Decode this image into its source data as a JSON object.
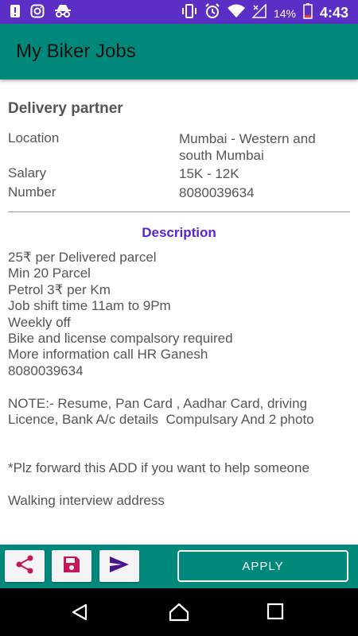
{
  "status_bar": {
    "battery_percent": "14%",
    "time": "4:43",
    "left_icons": [
      "alert-icon",
      "instagram-icon",
      "incognito-icon"
    ],
    "right_icons": [
      "vibrate-icon",
      "alarm-icon",
      "wifi-icon",
      "no-signal-icon",
      "battery-icon"
    ]
  },
  "app_bar": {
    "title": "My Biker Jobs"
  },
  "job": {
    "title": "Delivery partner",
    "location_label": "Location",
    "location_value": "Mumbai - Western and south Mumbai",
    "salary_label": "Salary",
    "salary_value": "15K - 12K",
    "number_label": "Number",
    "number_value": "8080039634"
  },
  "description": {
    "heading": "Description",
    "body": "25₹ per Delivered parcel\nMin 20 Parcel\nPetrol 3₹ per Km\nJob shift time 11am to 9Pm\nWeekly off\nBike and license compalsory required\nMore information call HR Ganesh\n8080039634\n\nNOTE:- Resume, Pan Card , Aadhar Card, driving Licence, Bank A/c details  Compulsary And 2 photo\n\n\n*Plz forward this ADD if you want to help someone\n\nWalking interview address"
  },
  "bottom_bar": {
    "apply_label": "APPLY",
    "icons": [
      "share-icon",
      "save-icon",
      "send-icon"
    ]
  },
  "colors": {
    "status_bar": "#5b2fc6",
    "teal": "#00897b",
    "description_heading": "#5b1fd6",
    "icon_red": "#c2185b",
    "send_purple": "#4a148c"
  }
}
